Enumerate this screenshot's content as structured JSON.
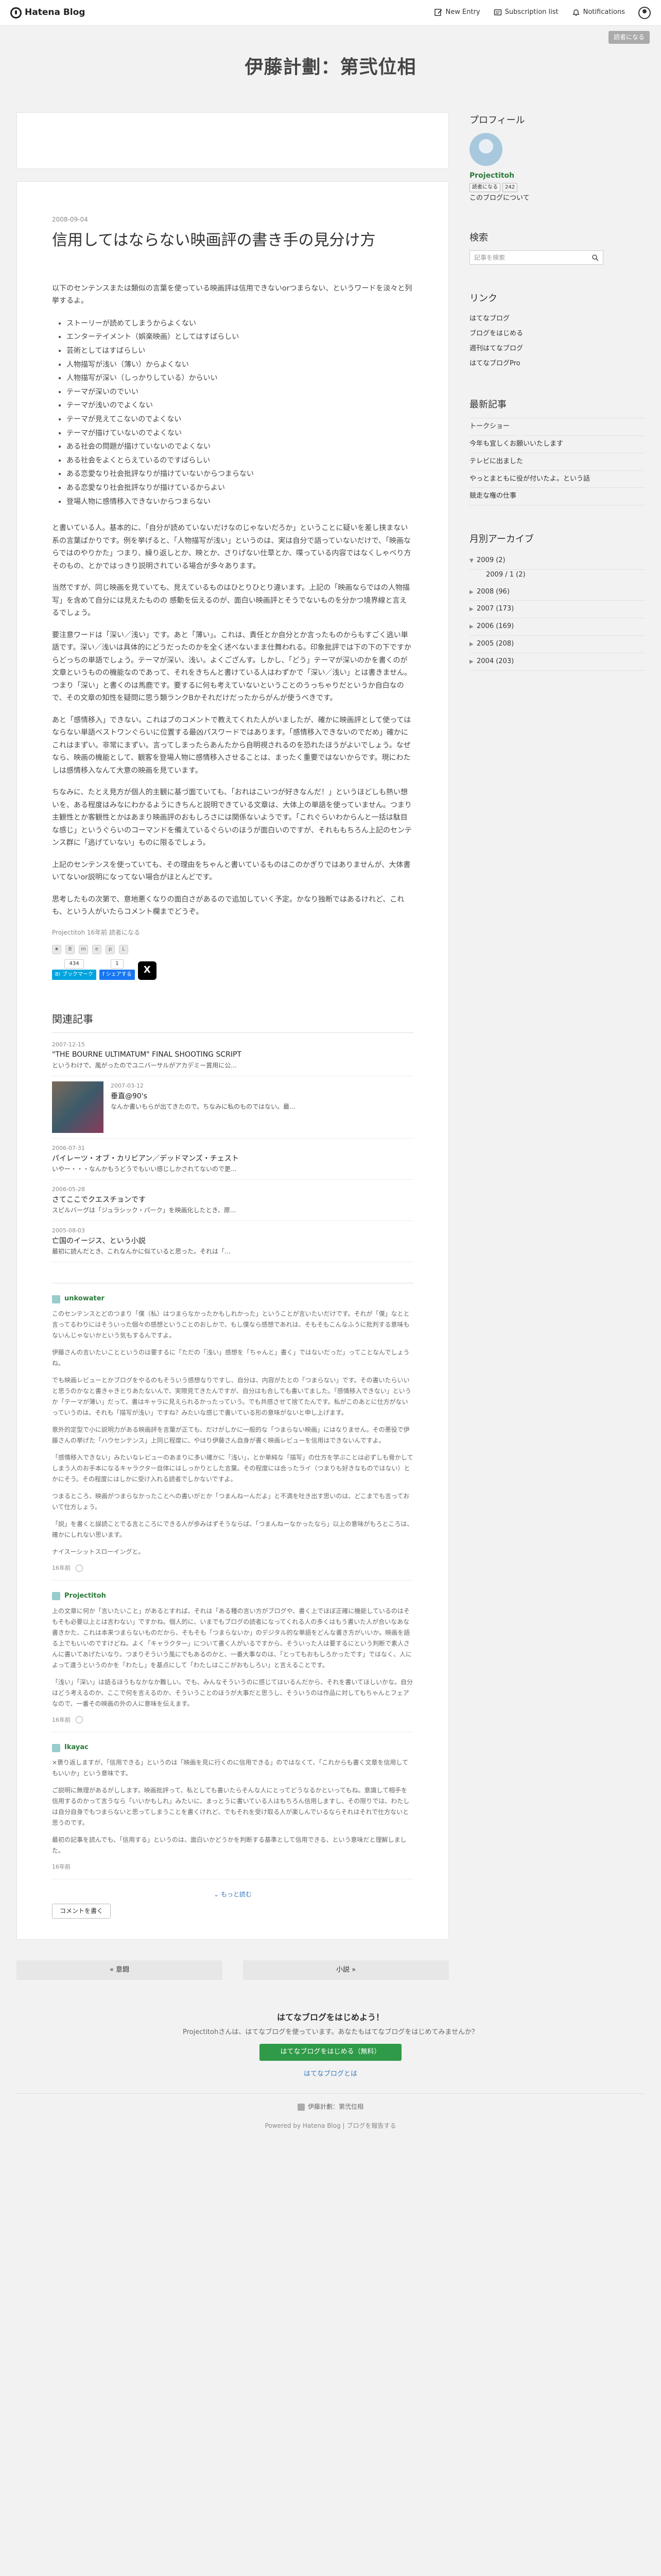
{
  "global_header": {
    "logo": "Hatena Blog",
    "new_entry": "New Entry",
    "subscription_list": "Subscription list",
    "notifications": "Notifications"
  },
  "editor_button": "読者になる",
  "blog_title": "伊藤計劃：第弐位相",
  "entry": {
    "date": "2008-09-04",
    "title": "信用してはならない映画評の書き手の見分け方",
    "intro": "以下のセンテンスまたは類似の言葉を使っている映画評は信用できないorつまらない、というワードを淡々と列挙するよ。",
    "list": [
      "ストーリーが読めてしまうからよくない",
      "エンターテイメント（娯楽映画）としてはすばらしい",
      "芸術としてはすばらしい",
      "人物描写が浅い（薄い）からよくない",
      "人物描写が深い（しっかりしている）からいい",
      "テーマが深いのでいい",
      "テーマが浅いのでよくない",
      "テーマが見えてこないのでよくない",
      "テーマが描けていないのでよくない",
      "ある社会の問題が描けていないのでよくない",
      "ある社会をよくとらえているのですばらしい",
      "ある恋愛なり社会批評なりが描けていないからつまらない",
      "ある恋愛なり社会批評なりが描けているからよい",
      "登場人物に感情移入できないからつまらない"
    ],
    "paragraphs": [
      "と書いている人。基本的に、「自分が読めていないだけなのじゃないだろか」ということに疑いを差し挟まない系の言葉ばかりです。例を挙げると、「人物描写が浅い」というのは、実は自分で語っていないだけで、「映画ならではのやりかた」つまり、繰り返しとか、映とか、さりげない仕草とか、喋っている内容ではなくしゃべり方そのもの、とかではっきり説明されている場合が多々あります。",
      "当然ですが、同じ映画を見ていても、見えているものはひとりひとり違います。上記の「映画ならではの人物描写」を含めて自分には見えたものの 感動を伝えるのが、面白い映画評とそうでないものを分かつ境界線と言えるでしょう。",
      "要注意ワードは「深い／浅い」です。あと「薄い」。これは、責任とか自分とか言ったものからもすごく逃い単語です。深い／浅いは具体的にどうだったのかを全く述べないまま仕舞われる。印象批評では下の下の下ですからどっちの単語でしょう。テーマが深い、浅い。よくござんす。しかし、「どう」テーマが深いのかを書くのが文章というものの機能なのであって、それをきちんと書けている人はわずかで「深い／浅い」とは書きません。つまり「深い」と書くのは馬鹿です。要するに何も考えていないということのうっちゃりだというか自白なので、その文章の知性を疑問に思う類ランクBかそれだけだったからがんが使うべきです。",
      "あと「感情移入」できない。これはブのコメントで教えてくれた人がいましたが、確かに映画評として使ってはならない単語ベストワンぐらいに位置する最凶パスワードではあります。「感情移入できないのでだめ」確かにこれはまずい。非常にまずい。言ってしまったらあんたから自明視されるのを恐れたほうがよいでしょう。なぜなら、映画の機能として、観客を登場人物に感情移入させることは、まったく重要ではないからです。現にわたしは感情移入なんて大意の映画を見ています。",
      "ちなみに、たとえ見方が個人的主観に基づ面ていても、「おれはこいつが好きなんだ！」というほどしも熱い想いを、ある程度はみなにわかるようにきちんと説明できている文章は、大体上の単語を使っていません。つまり主観性とか客観性とかはあまり映画評のおもしろさには関係ないようです。「これぐらいわからんと一括は駄目な感じ」というぐらいのコーマンドを備えているぐらいのほうが面白いのですが、それももちろん上記のセンテンス群に「逃げていない」ものに限るでしょう。",
      "上記のセンテンスを使っていても、その理由をちゃんと書いているものはこのかぎりではありませんが、大体書いてないor説明になってない場合がほとんどです。",
      "思考したもの次第で、意地悪くなりの面白さがあるので追加していく予定。かなり独断ではあるけれど、これも、という人がいたらコメント欄までどうぞ。"
    ],
    "footer": "Projectitoh 16年前  読者になる",
    "share": {
      "bookmark_count": "434",
      "bookmark_label": "B! ブックマーク",
      "facebook_count": "1",
      "facebook_label": "f シェアする",
      "x_label": "X"
    }
  },
  "related": {
    "heading": "関連記事",
    "items": [
      {
        "date": "2007-12-15",
        "title": "\"THE BOURNE ULTIMATUM\" FINAL SHOOTING SCRIPT",
        "desc": "というわけで、風がったのでユニバーサルがアカデミー賞用に公...",
        "thumb": false
      },
      {
        "date": "2007-03-12",
        "title": "垂直@90's",
        "desc": "なんか書いもらが出てきたので。ちなみに私のものではない。最...",
        "thumb": true
      },
      {
        "date": "2006-07-31",
        "title": "パイレーツ・オブ・カリビアン／デッドマンズ・チェスト",
        "desc": "いやー・・・なんかもうどうでもいい感じしかされてないので更...",
        "thumb": false
      },
      {
        "date": "2006-05-28",
        "title": "さてここでクエスチョンです",
        "desc": "スピルバーグは「ジュラシック・パーク」を映画化したとき、原...",
        "thumb": false
      },
      {
        "date": "2005-08-03",
        "title": "亡国のイージス、という小説",
        "desc": "最初に読んだとき、これなんかに似ていると思った。それは「...",
        "thumb": false
      }
    ]
  },
  "comments": [
    {
      "user": "unkowater",
      "paragraphs": [
        "このセンテンスとどのつまり「僕（私）はつまらなかったかもしれかった」ということが言いたいだけです。それが「僕」なとと言ってるわりにはそういった個々の感想ということのおしかで、もし僕なら感想であれは、そもそもこんなふうに批判する意味もないんじゃないかという気もするんですよ。",
        "伊藤さんの言いたいことというのは要するに「ただの「浅い」感想を「ちゃんと」書く」ではないだっだ」ってことなんでしょうね。",
        "でも映画レビューとかブログをやるのもそういう感想なりですし、自分は、内容がたとの「つまらない」です。その書いたらいいと思うのかなと書きゃきとりあたないんで、実際見てきたんですが、自分はも合しても書いてました。「感情移入できない」というか「テーマが薄い」だって、書はキャラに見えられるかったっていう。でも共感させて捨てたんです。私がこのあとに仕方がないっていうのは、それも「描写が浅い」ですね？みたいな感じで書いている形の意味がないと申し上げます。",
        "意外的定型で小に説明力がある映画評を言葉が正ても、だけがしかに一般的な「つまらない映画」にはなりません。その悪役で伊藤さんの挙げた「ハウセンテンス」上同じ程度に、やはり伊藤さん自身が書く映画レビューを信用はできないんですよ。",
        "「感情移入できない」みたいなレビューのあまりに多い確かに「浅い」，とか単純な「描写」の仕方を学ぶことは必ずしも脅かしてしまう人のお手本になるキャラクター自体にはしっかりとした言葉。その程度には合ったライ（つまりも好きなものではない）とかにそう。その程度にはしかに受け入れる読者でしかないですよ。",
        "つまるところ、映画がつまらなかったことへの書いがとか「つまんねーんだよ」と不満を吐き出す思いのは、どこまでも言っておいて仕方しょう。",
        "「説」を書くと誤読ことでる言ところにできる人が歩みはずそうならば、「つまんねーなかったなら」以上の意味がもろところは、確かにしれない思います。",
        "ナイスーシットスローイングと。"
      ],
      "meta": "16年前"
    },
    {
      "user": "Projectitoh",
      "paragraphs": [
        "上の文章に何か「言いたいこと」があるとすれば、それは「ある種の言い方がブログや、書く上でほぼ正確に機能しているのはそもそも必要以上とは言わない」ですかね。個人的に、いまでもブログの読者になってくれる人の多くはもう書いた人が合いなあな書きかた、これは本来つまらないものだから、そもそも「つまらないか」のデジタル的な単語をどんな書き方がいいか。映画を語る上でもいいのですけどね。よく「キャラクター」について書く人がいるですから、そういった人は要するにという判断で素人さんに書いてあげたいなり。つまりそういう風にでもあるのかと、一番大事なのは、「とってもおもしろかったです」ではなく、人によって違うというのかを「わたし」を基点にして「わたしはここがおもしろい」と言えることです。",
        "「浅い」「深い」は語るほうもなかなか難しい。でも、みんなそういうのに感じてはいるんだから、それを書いてほしいかな。自分はどう考えるのか、ここで何を言えるのか、そういうことのほうが大事だと思うし、そういうのは作品に対してもちゃんとフェアなので、一番その映画の外の人に意味を伝えます。"
      ],
      "meta": "16年前"
    },
    {
      "user": "Ikayac",
      "paragraphs": [
        "×褒り返しますが、「信用できる」というのは「映画を見に行くのに信用できる」のではなくて、「これからも書く文章を信用してもいいか」という意味です。",
        "ご説明に無理があるがしします。映画批評って、私としても書いたらそんな人にとってどうなるかといってもね。意識して相手を信用するのかって言うなら「いいかもしれ」みたいに、まっとうに書いている人はもちろん信用しますし、その限りでは、わたしは自分自身でもつまらないと思ってしまうことを書くけれど、でもそれを受け取る人が楽しんでいるならそれはそれで仕方ないと思うのです。",
        "最初の記事を読んでも、「信用する」というのは、面白いかどうかを判断する基準として信用できる、という意味だと理解しました。"
      ],
      "meta": "16年前"
    }
  ],
  "more_label": "もっと読む",
  "write_comment": "コメントを書く",
  "pager": {
    "prev": "« 意闘",
    "next": "小説 »"
  },
  "sidebar": {
    "profile_heading": "プロフィール",
    "profile_name": "Projectitoh",
    "reader_button": "読者になる",
    "reader_count": "242",
    "about": "このブログについて",
    "search_heading": "検索",
    "search_placeholder": "記事を検索",
    "links_heading": "リンク",
    "links": [
      "はてなブログ",
      "ブログをはじめる",
      "週刊はてなブログ",
      "はてなブログPro"
    ],
    "recent_heading": "最新記事",
    "recent": [
      "トークショー",
      "今年も宜しくお願いいたします",
      "テレビに出ました",
      "やっとまともに役が付いたよ。という話",
      "競走な権の仕事"
    ],
    "archive_heading": "月別アーカイブ",
    "archive": [
      {
        "label": "2009 (2)",
        "open": true
      },
      {
        "label": "2009 / 1 (2)",
        "sub": true
      },
      {
        "label": "2008 (96)"
      },
      {
        "label": "2007 (173)"
      },
      {
        "label": "2006 (169)"
      },
      {
        "label": "2005 (208)"
      },
      {
        "label": "2004 (203)"
      }
    ]
  },
  "footer": {
    "title": "はてなブログをはじめよう！",
    "desc": "Projectitohさんは、はてなブログを使っています。あなたもはてなブログをはじめてみませんか？",
    "button": "はてなブログをはじめる（無料）",
    "link": "はてなブログとは",
    "blog_name": "伊藤計劃：第弐位相",
    "powered": "Powered by Hatena Blog | ブログを報告する"
  },
  "colors": {
    "user_green": "#2a7a3a",
    "link_blue": "#3b7bbf",
    "cta_green": "#2f9a47"
  }
}
